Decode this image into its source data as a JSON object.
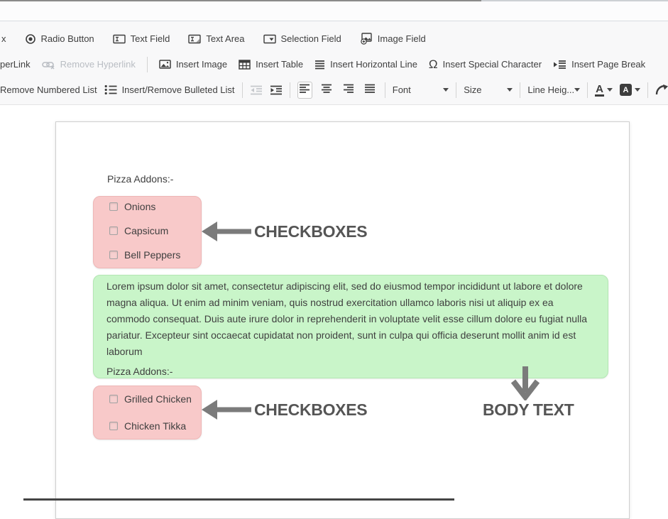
{
  "toolbar": {
    "row1": {
      "clipped_left": "x",
      "items": [
        "Radio Button",
        "Text Field",
        "Text Area",
        "Selection Field",
        "Image Field"
      ]
    },
    "row2": {
      "clipped_left": "perLink",
      "items": [
        "Remove Hyperlink",
        "Insert Image",
        "Insert Table",
        "Insert Horizontal Line",
        "Insert Special Character",
        "Insert Page Break"
      ]
    },
    "row3": {
      "clipped_left": "Remove Numbered List",
      "bulleted_label": "Insert/Remove Bulleted List",
      "font_label": "Font",
      "size_label": "Size",
      "line_height_label": "Line Heig...",
      "text_color_label": "A",
      "bg_color_label": "A"
    }
  },
  "editor": {
    "heading": "Pizza Addons:-",
    "checkbox_group_1": {
      "options": [
        "Onions",
        "Capsicum",
        "Bell Peppers"
      ]
    },
    "body_paragraph": "Lorem ipsum dolor sit amet, consectetur adipiscing elit, sed do eiusmod tempor incididunt ut labore et dolore magna aliqua. Ut enim ad minim veniam, quis nostrud exercitation ullamco laboris nisi ut aliquip ex ea commodo consequat. Duis aute irure dolor in reprehenderit in voluptate velit esse cillum dolore eu fugiat nulla pariatur. Excepteur sint occaecat cupidatat non proident, sunt in culpa qui officia deserunt mollit anim id est laborum",
    "body_heading": "Pizza Addons:-",
    "checkbox_group_2": {
      "options": [
        "Grilled Chicken",
        "Chicken Tikka"
      ]
    }
  },
  "annotations": {
    "checkbox_group_1_label": "CHECKBOXES",
    "checkbox_group_2_label": "CHECKBOXES",
    "body_text_label": "BODY TEXT"
  },
  "colors": {
    "checkbox_highlight": "#f8c9c9",
    "body_text_highlight": "#c9f5c9",
    "annotation_text": "#555555",
    "annotation_arrow": "#7b7b7b",
    "toolbar_background": "#f8f8f9"
  }
}
